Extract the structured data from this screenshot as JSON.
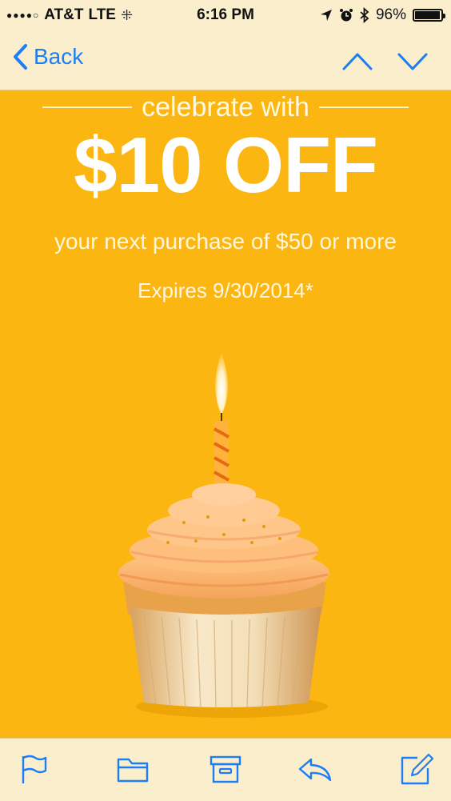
{
  "status_bar": {
    "signal": "●●●●○",
    "carrier": "AT&T",
    "network": "LTE",
    "time": "6:16 PM",
    "battery_text": "96%",
    "battery_level": 0.96
  },
  "nav": {
    "back_label": "Back"
  },
  "email": {
    "celebrate_text": "celebrate with",
    "headline": "$10 OFF",
    "subline": "your next purchase of $50 or more",
    "expires": "Expires 9/30/2014*"
  },
  "colors": {
    "background": "#fbb612",
    "bar_background": "#fbeecd",
    "accent_blue": "#1c7ef5"
  },
  "toolbar": {
    "icons": [
      "flag-icon",
      "folder-icon",
      "archive-icon",
      "reply-icon",
      "compose-icon"
    ]
  }
}
